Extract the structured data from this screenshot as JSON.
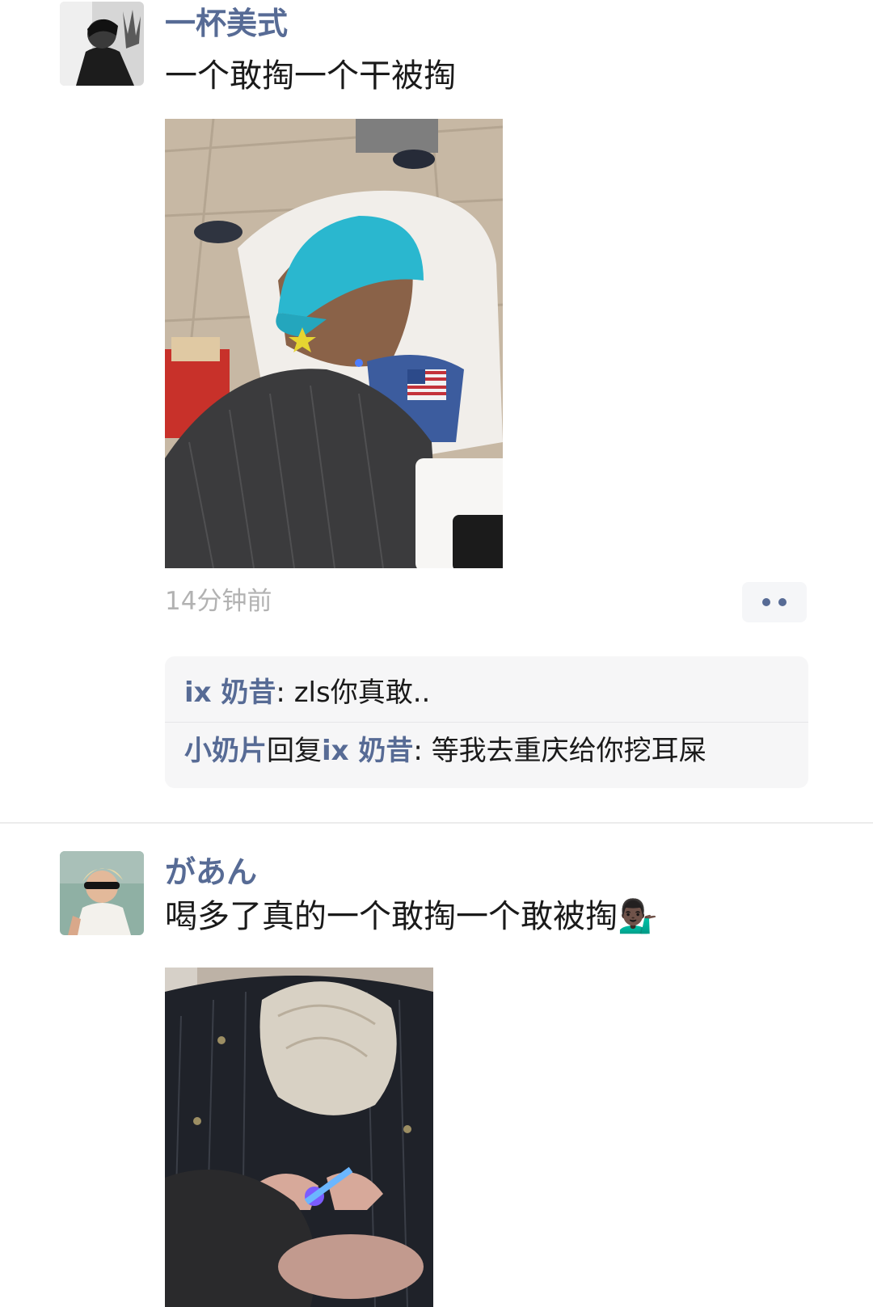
{
  "posts": [
    {
      "username": "一杯美式",
      "text": "一个敢掏一个干被掏",
      "time": "14分钟前",
      "comments": [
        {
          "author": "ix 奶昔",
          "separator": ": ",
          "text": "zls你真敢.."
        },
        {
          "author": "小奶片",
          "reply_word": "回复",
          "reply_to": "ix 奶昔",
          "separator": ": ",
          "text": "等我去重庆给你挖耳屎"
        }
      ]
    },
    {
      "username": "があん",
      "text": "喝多了真的一个敢掏一个敢被掏💁🏿‍♂️"
    }
  ],
  "colors": {
    "nickname": "#576b95",
    "text": "#1a1a1a",
    "time": "#b2b2b2",
    "comment_bg": "#f6f6f7"
  },
  "icons": {
    "more": "more-dots-icon"
  }
}
